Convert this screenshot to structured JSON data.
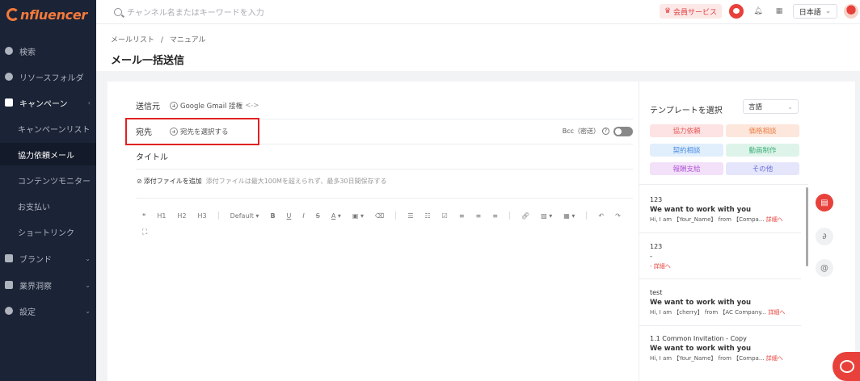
{
  "app": {
    "logo_text": "nfluencer"
  },
  "topbar": {
    "search_placeholder": "チャンネル名またはキーワードを入力",
    "vip_label": "会員サービス",
    "language": "日本語"
  },
  "sidebar": {
    "items": [
      {
        "label": "検索"
      },
      {
        "label": "リソースフォルダ"
      },
      {
        "label": "キャンペーン"
      },
      {
        "label": "キャンペーンリスト"
      },
      {
        "label": "協力依頼メール"
      },
      {
        "label": "コンテンツモニター"
      },
      {
        "label": "お支払い"
      },
      {
        "label": "ショートリンク"
      },
      {
        "label": "ブランド"
      },
      {
        "label": "業界洞察"
      },
      {
        "label": "設定"
      }
    ]
  },
  "breadcrumb": {
    "part1": "メールリスト",
    "sep": "/",
    "part2": "マニュアル"
  },
  "page": {
    "title": "メール一括送信"
  },
  "compose": {
    "sender_label": "送信元",
    "sender_value": "Google Gmail 接権",
    "sender_arrow": "<->",
    "recipient_label": "宛先",
    "recipient_add": "宛先を選択する",
    "bcc_label": "Bcc（密送）",
    "title_label": "タイトル",
    "attach_label": "添付ファイルを追加",
    "attach_hint": "添付ファイルは最大100Mを超えられず、最多30日間保存する"
  },
  "editor_toolbar": {
    "quote": "❝",
    "h1": "H1",
    "h2": "H2",
    "h3": "H3",
    "font": "Default",
    "bold": "B",
    "underline": "U",
    "italic": "I",
    "strike": "S",
    "text_color": "A",
    "expand": "⛶"
  },
  "templates": {
    "title": "テンプレートを選択",
    "select_value": "言語",
    "tags": [
      {
        "label": "協力依頼",
        "bg": "#fde3e3",
        "fg": "#e55a5a"
      },
      {
        "label": "価格相談",
        "bg": "#fde7dc",
        "fg": "#e8804a"
      },
      {
        "label": "契約相談",
        "bg": "#e1eefc",
        "fg": "#4a8ee0"
      },
      {
        "label": "動画制作",
        "bg": "#def4ea",
        "fg": "#3eae7a"
      },
      {
        "label": "報酬支給",
        "bg": "#f2e1f9",
        "fg": "#b35ad6"
      },
      {
        "label": "その他",
        "bg": "#e5e6fb",
        "fg": "#6a6fd8"
      }
    ],
    "items": [
      {
        "name": "123",
        "subject": "We want to work with you",
        "preview": "Hi, I am 【Your_Name】 from 【Compa...",
        "link": "詳細へ"
      },
      {
        "name": "123",
        "subject": "-",
        "preview": "-",
        "link": "詳細へ"
      },
      {
        "name": "test",
        "subject": "We want to work with you",
        "preview": "Hi, I am 【cherry】 from 【AC Company...",
        "link": "詳細へ"
      },
      {
        "name": "1.1 Common Invitation - Copy",
        "subject": "We want to work with you",
        "preview": "Hi, I am 【Your_Name】 from 【Compa...",
        "link": "詳細へ"
      }
    ]
  }
}
